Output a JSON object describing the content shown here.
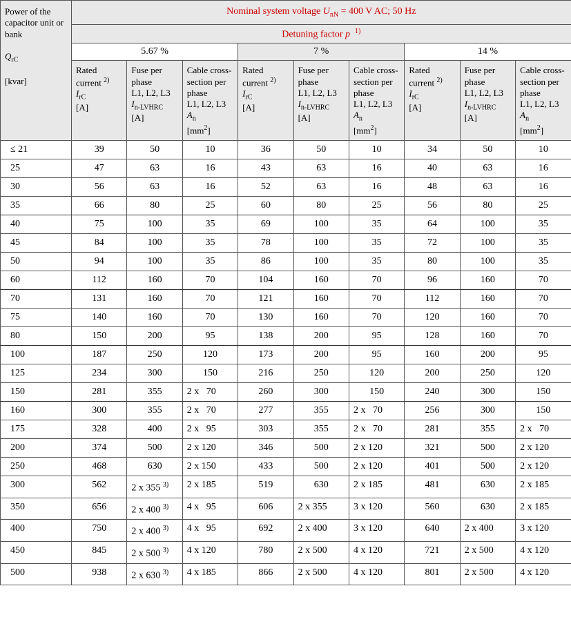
{
  "header": {
    "titleLine": "Nominal system voltage U_nN = 400 V AC; 50 Hz",
    "detuningLine": "Detuning factor p  1)",
    "levels": [
      "5.67 %",
      "7 %",
      "14 %"
    ],
    "rowHead": {
      "line1": "Power of the capacitor unit or bank",
      "symbol": "Q_rC",
      "unit": "[kvar]"
    },
    "colHeads": {
      "rated": {
        "line1": "Rated current 2)",
        "symbol": "I_rC",
        "unit": "[A]"
      },
      "fuse": {
        "line1": "Fuse per phase",
        "line2": "L1, L2, L3",
        "symbol": "I_n-LVHRC",
        "unit": "[A]"
      },
      "cable": {
        "line1": "Cable cross-section per phase",
        "line2": "L1, L2, L3",
        "symbol": "A_n",
        "unit": "[mm2]"
      }
    }
  },
  "chart_data": {
    "type": "table",
    "title": "Fuse and cable sizing for detuned capacitor units at 400 V AC; 50 Hz",
    "columns": [
      "Q_rC [kvar]",
      "5.67% I_rC [A]",
      "5.67% I_n-LVHRC [A]",
      "5.67% A_n [mm2]",
      "7% I_rC [A]",
      "7% I_n-LVHRC [A]",
      "7% A_n [mm2]",
      "14% I_rC [A]",
      "14% I_n-LVHRC [A]",
      "14% A_n [mm2]"
    ],
    "rows": [
      [
        "≤ 21",
        "39",
        "50",
        "10",
        "36",
        "50",
        "10",
        "34",
        "50",
        "10"
      ],
      [
        "25",
        "47",
        "63",
        "16",
        "43",
        "63",
        "16",
        "40",
        "63",
        "16"
      ],
      [
        "30",
        "56",
        "63",
        "16",
        "52",
        "63",
        "16",
        "48",
        "63",
        "16"
      ],
      [
        "35",
        "66",
        "80",
        "25",
        "60",
        "80",
        "25",
        "56",
        "80",
        "25"
      ],
      [
        "40",
        "75",
        "100",
        "35",
        "69",
        "100",
        "35",
        "64",
        "100",
        "35"
      ],
      [
        "45",
        "84",
        "100",
        "35",
        "78",
        "100",
        "35",
        "72",
        "100",
        "35"
      ],
      [
        "50",
        "94",
        "100",
        "35",
        "86",
        "100",
        "35",
        "80",
        "100",
        "35"
      ],
      [
        "60",
        "112",
        "160",
        "70",
        "104",
        "160",
        "70",
        "96",
        "160",
        "70"
      ],
      [
        "70",
        "131",
        "160",
        "70",
        "121",
        "160",
        "70",
        "112",
        "160",
        "70"
      ],
      [
        "75",
        "140",
        "160",
        "70",
        "130",
        "160",
        "70",
        "120",
        "160",
        "70"
      ],
      [
        "80",
        "150",
        "200",
        "95",
        "138",
        "200",
        "95",
        "128",
        "160",
        "70"
      ],
      [
        "100",
        "187",
        "250",
        "120",
        "173",
        "200",
        "95",
        "160",
        "200",
        "95"
      ],
      [
        "125",
        "234",
        "300",
        "150",
        "216",
        "250",
        "120",
        "200",
        "250",
        "120"
      ],
      [
        "150",
        "281",
        "355",
        "2 x   70",
        "260",
        "300",
        "150",
        "240",
        "300",
        "150"
      ],
      [
        "160",
        "300",
        "355",
        "2 x   70",
        "277",
        "355",
        "2 x   70",
        "256",
        "300",
        "150"
      ],
      [
        "175",
        "328",
        "400",
        "2 x   95",
        "303",
        "355",
        "2 x   70",
        "281",
        "355",
        "2 x   70"
      ],
      [
        "200",
        "374",
        "500",
        "2 x 120",
        "346",
        "500",
        "2 x 120",
        "321",
        "500",
        "2 x 120"
      ],
      [
        "250",
        "468",
        "630",
        "2 x 150",
        "433",
        "500",
        "2 x 120",
        "401",
        "500",
        "2 x 120"
      ],
      [
        "300",
        "562",
        "2 x 355  3)",
        "2 x 185",
        "519",
        "630",
        "2 x 185",
        "481",
        "630",
        "2 x 185"
      ],
      [
        "350",
        "656",
        "2 x 400  3)",
        "4 x   95",
        "606",
        "2 x 355",
        "3 x 120",
        "560",
        "630",
        "2 x 185"
      ],
      [
        "400",
        "750",
        "2 x 400  3)",
        "4 x   95",
        "692",
        "2 x 400",
        "3 x 120",
        "640",
        "2 x 400",
        "3 x 120"
      ],
      [
        "450",
        "845",
        "2 x 500  3)",
        "4 x 120",
        "780",
        "2 x 500",
        "4 x 120",
        "721",
        "2 x 500",
        "4 x 120"
      ],
      [
        "500",
        "938",
        "2 x 630  3)",
        "4 x 185",
        "866",
        "2 x 500",
        "4 x 120",
        "801",
        "2 x 500",
        "4 x 120"
      ]
    ]
  }
}
